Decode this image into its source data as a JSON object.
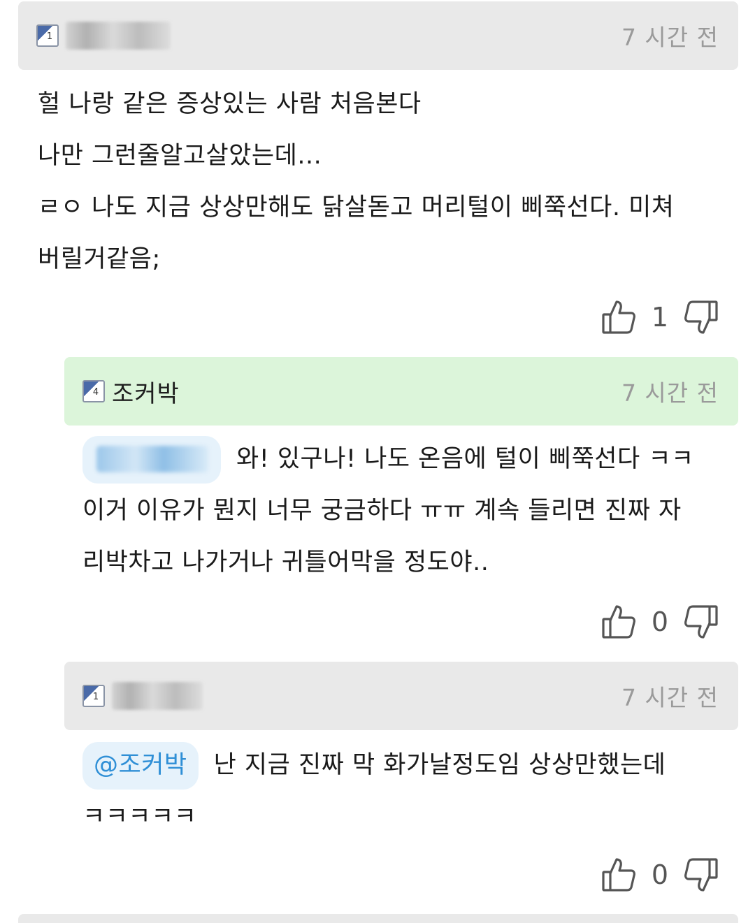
{
  "comments": [
    {
      "author_level": "1",
      "author": "",
      "time": "7 시간 전",
      "lines": [
        "헐 나랑 같은 증상있는 사람 처음본다",
        "나만 그런줄알고살았는데...",
        "ㄹㅇ 나도 지금 상상만해도 닭살돋고 머리털이 삐쭉선다. 미쳐",
        "버릴거같음;"
      ],
      "likes": "1"
    },
    {
      "author_level": "4",
      "author": "조커박",
      "time": "7 시간 전",
      "mention": "",
      "lines": [
        "와! 있구나! 나도 온음에 털이 삐쭉선다 ㅋㅋ",
        "이거 이유가 뭔지 너무 궁금하다 ㅠㅠ 계속 들리면 진짜 자",
        "리박차고 나가거나 귀틀어막을 정도야.."
      ],
      "likes": "0"
    },
    {
      "author_level": "1",
      "author": "",
      "time": "7 시간 전",
      "mention": "@조커박",
      "lines": [
        "난 지금 진짜 막 화가날정도임 상상만했는데",
        "ㅋㅋㅋㅋㅋ"
      ],
      "likes": "0"
    }
  ],
  "icons": {
    "like": "thumbs-up-icon",
    "dislike": "thumbs-down-icon"
  },
  "colors": {
    "header_grey": "#e9e9e9",
    "header_green": "#dcf5da",
    "mention_bg": "#e6f2fb",
    "mention_text": "#2f8fd6",
    "timestamp": "#9a9a9a"
  }
}
